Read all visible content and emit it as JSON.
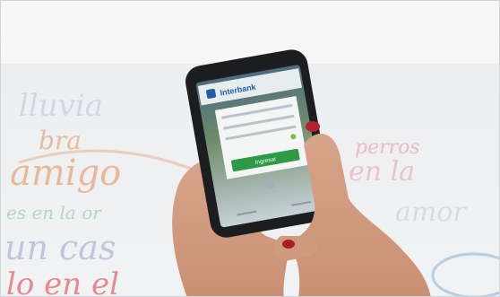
{
  "photo": {
    "wall_words": [
      {
        "text": "lluvia",
        "color": "#c7d0e4"
      },
      {
        "text": "bra",
        "color": "#e6b08a"
      },
      {
        "text": "amigo",
        "color": "#e9a67c"
      },
      {
        "text": "es en la or",
        "color": "#a9d3b4"
      },
      {
        "text": "un cas",
        "color": "#b8bfd8"
      },
      {
        "text": "lo en el",
        "color": "#e47f86"
      },
      {
        "text": "en la",
        "color": "#e9b9c3"
      },
      {
        "text": "perros",
        "color": "#eba5ad"
      },
      {
        "text": "amor",
        "color": "#cdd6e6"
      }
    ],
    "phone_app": {
      "brand": "Interbank",
      "action_button": "Ingresar"
    }
  }
}
